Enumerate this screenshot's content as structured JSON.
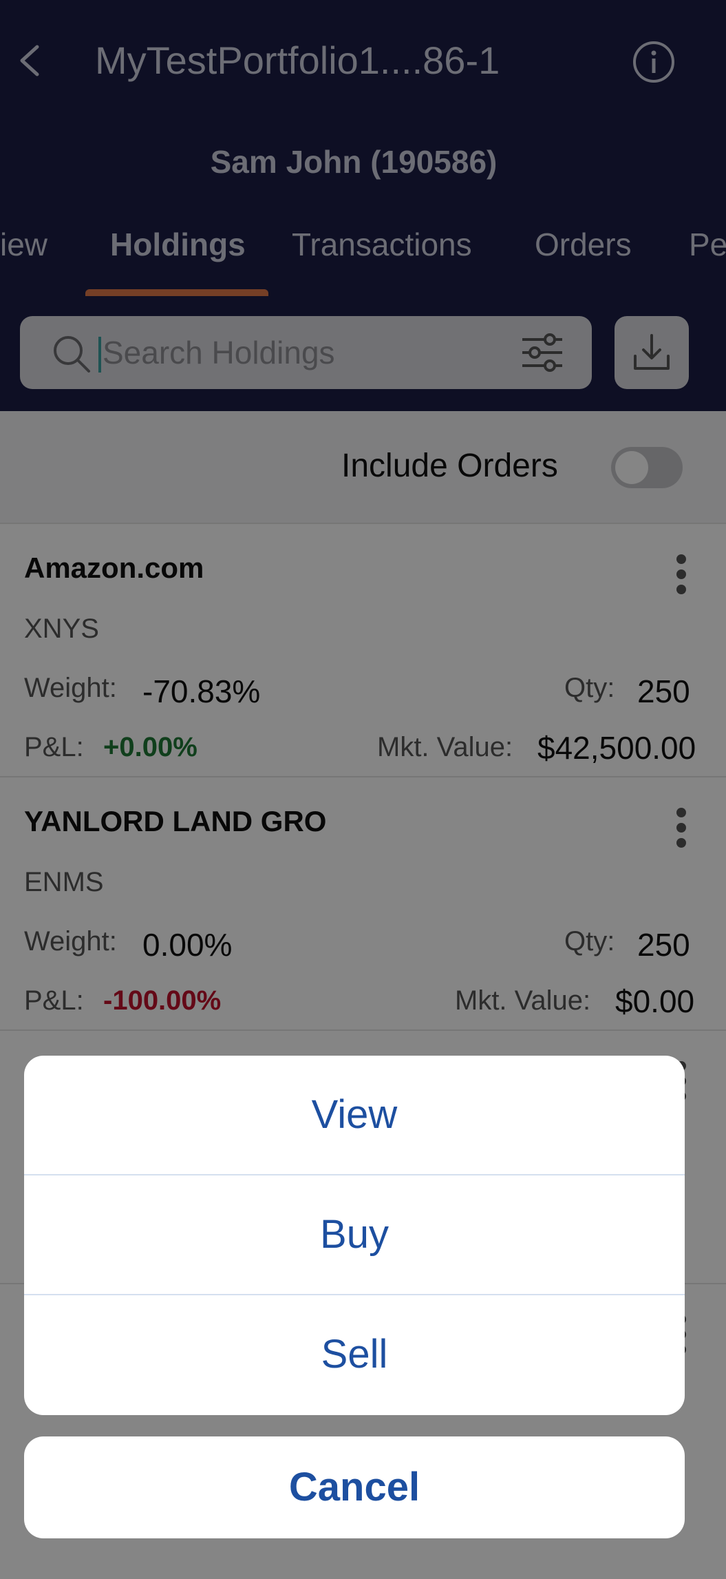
{
  "header": {
    "title": "MyTestPortfolio1....86-1",
    "client": "Sam John (190586)",
    "tabs": [
      "iew",
      "Holdings",
      "Transactions",
      "Orders",
      "Pe"
    ],
    "active_tab": "Holdings"
  },
  "search": {
    "placeholder": "Search Holdings"
  },
  "include_orders": {
    "label": "Include Orders",
    "enabled": false
  },
  "holdings": [
    {
      "name": "Amazon.com",
      "exchange": "XNYS",
      "weight_label": "Weight:",
      "weight": "-70.83%",
      "qty_label": "Qty:",
      "qty": "250",
      "pnl_label": "P&L:",
      "pnl": "+0.00%",
      "mkt_label": "Mkt. Value:",
      "mkt_value": "$42,500.00"
    },
    {
      "name": "YANLORD LAND GRO",
      "exchange": "ENMS",
      "weight_label": "Weight:",
      "weight": "0.00%",
      "qty_label": "Qty:",
      "qty": "250",
      "pnl_label": "P&L:",
      "pnl": "-100.00%",
      "mkt_label": "Mkt. Value:",
      "mkt_value": "$0.00"
    }
  ],
  "action_sheet": {
    "items": [
      "View",
      "Buy",
      "Sell"
    ],
    "cancel": "Cancel"
  },
  "colors": {
    "header_bg": "#1b1d45",
    "accent": "#e07a4a",
    "positive": "#1f7a36",
    "negative": "#c0132c",
    "sheet_text": "#1d4fa0"
  },
  "icons": [
    "back-icon",
    "info-icon",
    "search-icon",
    "filter-icon",
    "download-icon",
    "more-vertical-icon"
  ]
}
